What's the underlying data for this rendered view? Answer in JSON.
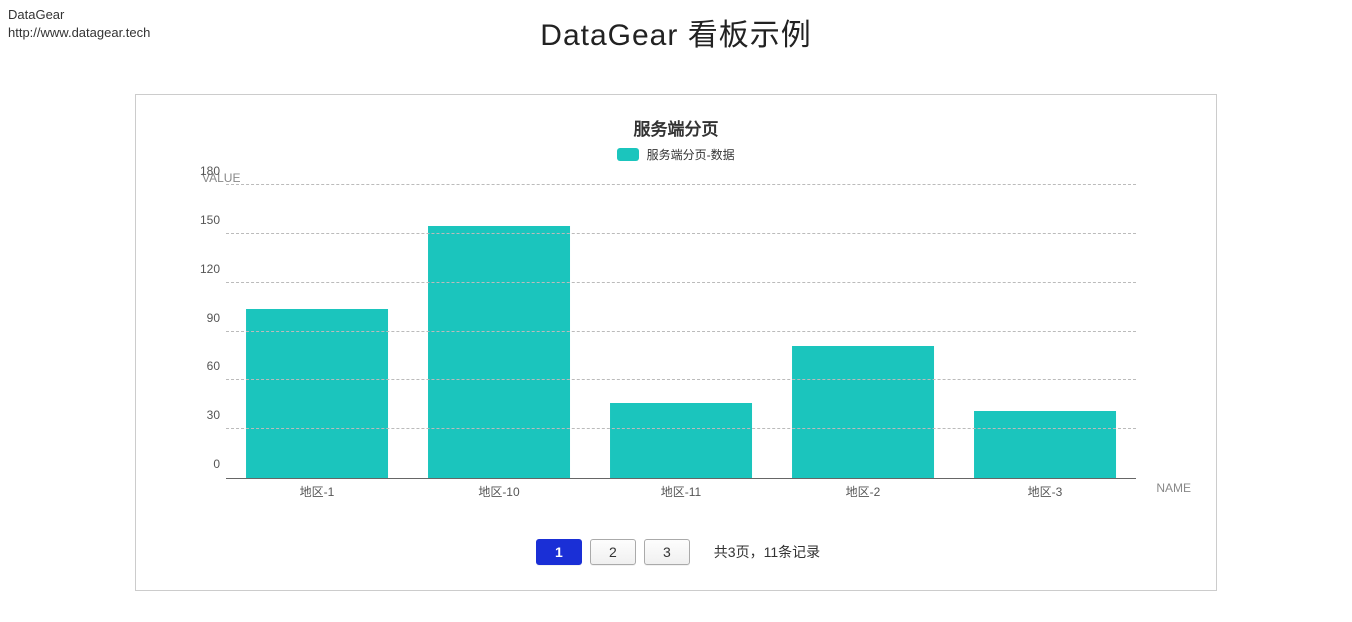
{
  "header": {
    "brand": "DataGear",
    "url": "http://www.datagear.tech",
    "page_title": "DataGear 看板示例"
  },
  "chart_data": {
    "type": "bar",
    "title": "服务端分页",
    "legend": "服务端分页-数据",
    "xlabel": "NAME",
    "ylabel": "VALUE",
    "categories": [
      "地区-1",
      "地区-10",
      "地区-11",
      "地区-2",
      "地区-3"
    ],
    "values": [
      104,
      155,
      46,
      81,
      41
    ],
    "ylim": [
      0,
      180
    ],
    "yticks": [
      0,
      30,
      60,
      90,
      120,
      150,
      180
    ],
    "bar_color": "#1bc5bd"
  },
  "pagination": {
    "current": 1,
    "pages": [
      "1",
      "2",
      "3"
    ],
    "summary": "共3页，11条记录"
  }
}
